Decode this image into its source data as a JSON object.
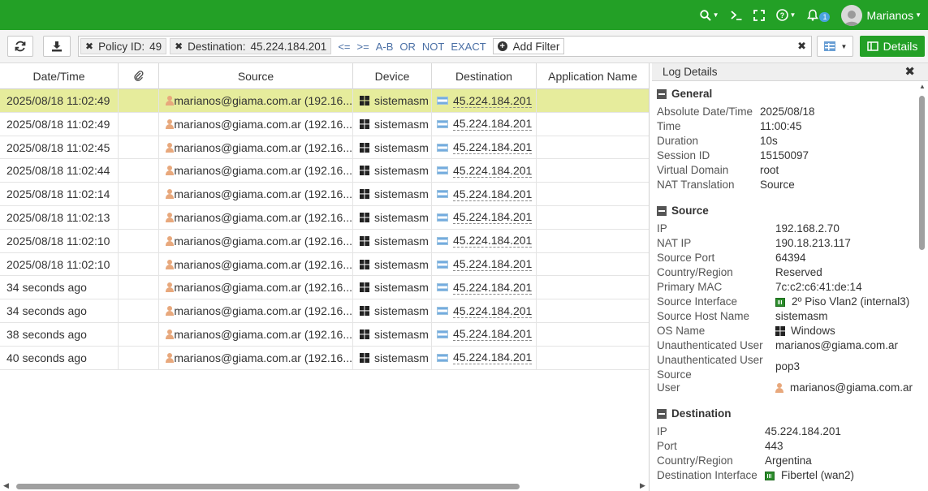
{
  "topbar": {
    "username": "Marianos",
    "notification_count": "1",
    "brand_color": "#23a026"
  },
  "toolbar": {
    "filters": [
      {
        "label": "Policy ID:",
        "value": "49"
      },
      {
        "label": "Destination:",
        "value": "45.224.184.201"
      }
    ],
    "operators": [
      "<=",
      ">=",
      "A-B",
      "OR",
      "NOT",
      "EXACT"
    ],
    "add_filter_label": "Add Filter",
    "details_label": "Details"
  },
  "table": {
    "columns": [
      "Date/Time",
      "",
      "Source",
      "Device",
      "Destination",
      "Application Name"
    ],
    "rows": [
      {
        "time": "2025/08/18 11:02:49",
        "source": "marianos@giama.com.ar (192.16...",
        "device": "sistemasm",
        "destination": "45.224.184.201",
        "app": ""
      },
      {
        "time": "2025/08/18 11:02:49",
        "source": "marianos@giama.com.ar (192.16...",
        "device": "sistemasm",
        "destination": "45.224.184.201",
        "app": ""
      },
      {
        "time": "2025/08/18 11:02:45",
        "source": "marianos@giama.com.ar (192.16...",
        "device": "sistemasm",
        "destination": "45.224.184.201",
        "app": ""
      },
      {
        "time": "2025/08/18 11:02:44",
        "source": "marianos@giama.com.ar (192.16...",
        "device": "sistemasm",
        "destination": "45.224.184.201",
        "app": ""
      },
      {
        "time": "2025/08/18 11:02:14",
        "source": "marianos@giama.com.ar (192.16...",
        "device": "sistemasm",
        "destination": "45.224.184.201",
        "app": ""
      },
      {
        "time": "2025/08/18 11:02:13",
        "source": "marianos@giama.com.ar (192.16...",
        "device": "sistemasm",
        "destination": "45.224.184.201",
        "app": ""
      },
      {
        "time": "2025/08/18 11:02:10",
        "source": "marianos@giama.com.ar (192.16...",
        "device": "sistemasm",
        "destination": "45.224.184.201",
        "app": ""
      },
      {
        "time": "2025/08/18 11:02:10",
        "source": "marianos@giama.com.ar (192.16...",
        "device": "sistemasm",
        "destination": "45.224.184.201",
        "app": ""
      },
      {
        "time": "34 seconds ago",
        "source": "marianos@giama.com.ar (192.16...",
        "device": "sistemasm",
        "destination": "45.224.184.201",
        "app": ""
      },
      {
        "time": "34 seconds ago",
        "source": "marianos@giama.com.ar (192.16...",
        "device": "sistemasm",
        "destination": "45.224.184.201",
        "app": ""
      },
      {
        "time": "38 seconds ago",
        "source": "marianos@giama.com.ar (192.16...",
        "device": "sistemasm",
        "destination": "45.224.184.201",
        "app": ""
      },
      {
        "time": "40 seconds ago",
        "source": "marianos@giama.com.ar (192.16...",
        "device": "sistemasm",
        "destination": "45.224.184.201",
        "app": ""
      }
    ],
    "selected_row_color": "#e6ec9c"
  },
  "details": {
    "title": "Log Details",
    "general": {
      "heading": "General",
      "items": [
        {
          "k": "Absolute Date/Time",
          "v": "2025/08/18"
        },
        {
          "k": "Time",
          "v": "11:00:45"
        },
        {
          "k": "Duration",
          "v": "10s"
        },
        {
          "k": "Session ID",
          "v": "15150097"
        },
        {
          "k": "Virtual Domain",
          "v": "root"
        },
        {
          "k": "NAT Translation",
          "v": "Source"
        }
      ]
    },
    "source": {
      "heading": "Source",
      "items": [
        {
          "k": "IP",
          "v": "192.168.2.70"
        },
        {
          "k": "NAT IP",
          "v": "190.18.213.117"
        },
        {
          "k": "Source Port",
          "v": "64394"
        },
        {
          "k": "Country/Region",
          "v": "Reserved"
        },
        {
          "k": "Primary MAC",
          "v": "7c:c2:c6:41:de:14"
        },
        {
          "k": "Source Interface",
          "v": "2º Piso Vlan2 (internal3)"
        },
        {
          "k": "Source Host Name",
          "v": "sistemasm"
        },
        {
          "k": "OS Name",
          "v": "Windows"
        },
        {
          "k": "Unauthenticated User",
          "v": "marianos@giama.com.ar"
        },
        {
          "k": "Unauthenticated User Source",
          "v": "pop3"
        },
        {
          "k": "User",
          "v": "marianos@giama.com.ar"
        }
      ]
    },
    "destination": {
      "heading": "Destination",
      "items": [
        {
          "k": "IP",
          "v": "45.224.184.201"
        },
        {
          "k": "Port",
          "v": "443"
        },
        {
          "k": "Country/Region",
          "v": "Argentina"
        },
        {
          "k": "Destination Interface",
          "v": "Fibertel (wan2)"
        }
      ]
    }
  }
}
